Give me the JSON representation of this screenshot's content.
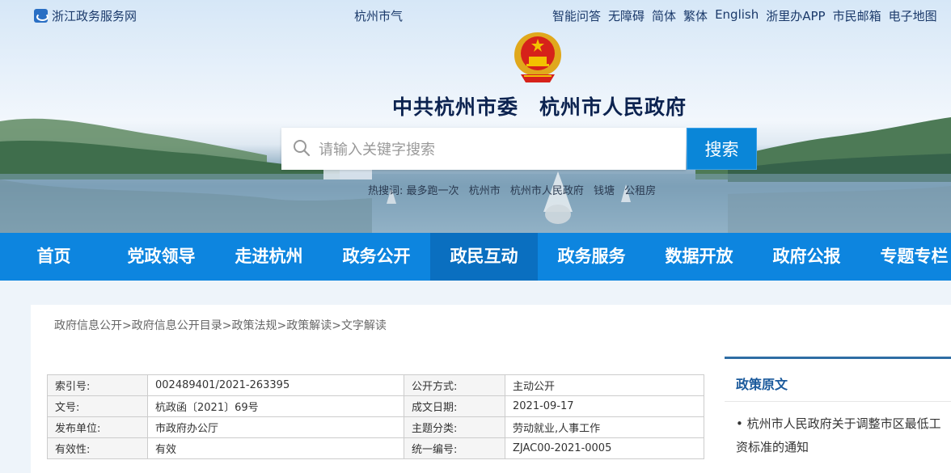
{
  "topbar": {
    "portal_label": "浙江政务服务网",
    "weather_label": "杭州市气",
    "links": [
      "智能问答",
      "无障碍",
      "简体",
      "繁体",
      "English",
      "浙里办APP",
      "市民邮箱",
      "电子地图"
    ]
  },
  "site_title": "中共杭州市委　杭州市人民政府",
  "search": {
    "placeholder": "请输入关键字搜索",
    "button_label": "搜索",
    "hot_label": "热搜词:",
    "hot_words": [
      "最多跑一次",
      "杭州市",
      "杭州市人民政府",
      "钱塘",
      "公租房"
    ]
  },
  "nav": {
    "items": [
      "首页",
      "党政领导",
      "走进杭州",
      "政务公开",
      "政民互动",
      "政务服务",
      "数据开放",
      "政府公报",
      "专题专栏"
    ],
    "active": "政民互动"
  },
  "breadcrumb": {
    "items": [
      "政府信息公开",
      "政府信息公开目录",
      "政策法规",
      "政策解读",
      "文字解读"
    ],
    "separator": ">"
  },
  "meta_table": {
    "rows": [
      {
        "k1": "索引号:",
        "v1": "002489401/2021-263395",
        "k2": "公开方式:",
        "v2": "主动公开"
      },
      {
        "k1": "文号:",
        "v1": "杭政函〔2021〕69号",
        "k2": "成文日期:",
        "v2": "2021-09-17"
      },
      {
        "k1": "发布单位:",
        "v1": "市政府办公厅",
        "k2": "主题分类:",
        "v2": "劳动就业,人事工作"
      },
      {
        "k1": "有效性:",
        "v1": "有效",
        "k2": "统一编号:",
        "v2": "ZJAC00-2021-0005"
      }
    ]
  },
  "side_panel": {
    "title": "政策原文",
    "doc_title": "杭州市人民政府关于调整市区最低工资标准的通知"
  },
  "colors": {
    "nav_bg": "#0d85df",
    "nav_active": "#0a6fc0",
    "search_button": "#0a86d8",
    "title": "#0c2350"
  }
}
